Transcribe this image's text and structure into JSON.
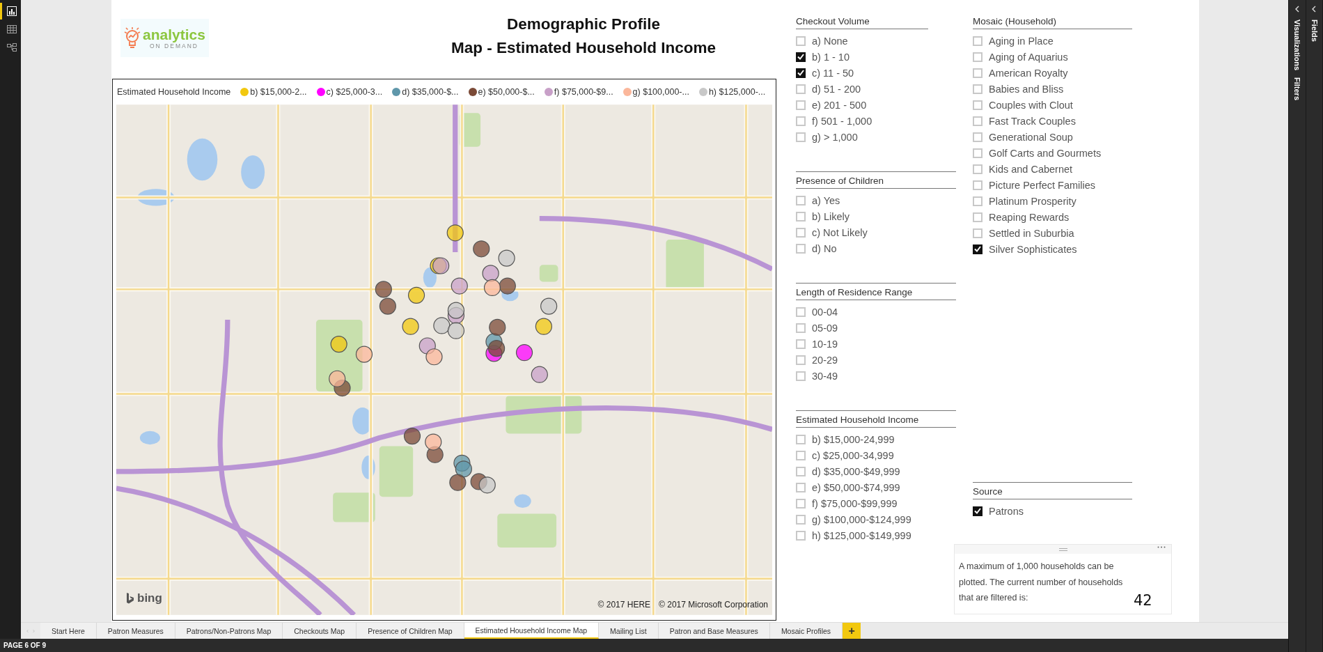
{
  "rail": {
    "icons": [
      {
        "kind": "report",
        "selected": true
      },
      {
        "kind": "data",
        "selected": false
      },
      {
        "kind": "model",
        "selected": false
      }
    ]
  },
  "logo": {
    "word": "analytics",
    "tagline": "ON DEMAND"
  },
  "title": [
    "Demographic Profile",
    "Map - Estimated Household Income"
  ],
  "map": {
    "legend_title": "Estimated Household Income",
    "legend": [
      {
        "label": "b) $15,000-2...",
        "color": "#f2c80f"
      },
      {
        "label": "c) $25,000-3...",
        "color": "#ff00ff"
      },
      {
        "label": "d) $35,000-$...",
        "color": "#5f97aa"
      },
      {
        "label": "e) $50,000-$...",
        "color": "#7b4a37"
      },
      {
        "label": "f) $75,000-$9...",
        "color": "#c8a0c8"
      },
      {
        "label": "g) $100,000-...",
        "color": "#fbb79b"
      },
      {
        "label": "h) $125,000-...",
        "color": "#c8c8c8"
      }
    ],
    "provider": "bing",
    "attribution": [
      "© 2017 HERE",
      "© 2017 Microsoft Corporation"
    ]
  },
  "slicers_left": [
    {
      "title": "Checkout Volume",
      "items": [
        {
          "label": "a) None",
          "checked": false
        },
        {
          "label": "b) 1 - 10",
          "checked": true
        },
        {
          "label": "c) 11 - 50",
          "checked": true
        },
        {
          "label": "d) 51 - 200",
          "checked": false
        },
        {
          "label": "e) 201 - 500",
          "checked": false
        },
        {
          "label": "f) 501 - 1,000",
          "checked": false
        },
        {
          "label": "g) > 1,000",
          "checked": false
        }
      ]
    },
    {
      "title": "Presence of Children",
      "items": [
        {
          "label": "a) Yes",
          "checked": false
        },
        {
          "label": "b) Likely",
          "checked": false
        },
        {
          "label": "c) Not Likely",
          "checked": false
        },
        {
          "label": "d) No",
          "checked": false
        }
      ]
    },
    {
      "title": "Length of Residence Range",
      "items": [
        {
          "label": "00-04",
          "checked": false
        },
        {
          "label": "05-09",
          "checked": false
        },
        {
          "label": "10-19",
          "checked": false
        },
        {
          "label": "20-29",
          "checked": false
        },
        {
          "label": "30-49",
          "checked": false
        }
      ]
    },
    {
      "title": "Estimated Household Income",
      "items": [
        {
          "label": "b) $15,000-24,999",
          "checked": false
        },
        {
          "label": "c) $25,000-34,999",
          "checked": false
        },
        {
          "label": "d) $35,000-$49,999",
          "checked": false
        },
        {
          "label": "e) $50,000-$74,999",
          "checked": false
        },
        {
          "label": "f) $75,000-$99,999",
          "checked": false
        },
        {
          "label": "g) $100,000-$124,999",
          "checked": false
        },
        {
          "label": "h) $125,000-$149,999",
          "checked": false
        }
      ]
    }
  ],
  "slicers_right": [
    {
      "title": "Mosaic (Household)",
      "items": [
        {
          "label": "Aging in Place",
          "checked": false
        },
        {
          "label": "Aging of Aquarius",
          "checked": false
        },
        {
          "label": "American Royalty",
          "checked": false
        },
        {
          "label": "Babies and Bliss",
          "checked": false
        },
        {
          "label": "Couples with Clout",
          "checked": false
        },
        {
          "label": "Fast Track Couples",
          "checked": false
        },
        {
          "label": "Generational Soup",
          "checked": false
        },
        {
          "label": "Golf Carts and Gourmets",
          "checked": false
        },
        {
          "label": "Kids and Cabernet",
          "checked": false
        },
        {
          "label": "Picture Perfect Families",
          "checked": false
        },
        {
          "label": "Platinum Prosperity",
          "checked": false
        },
        {
          "label": "Reaping Rewards",
          "checked": false
        },
        {
          "label": "Settled in Suburbia",
          "checked": false
        },
        {
          "label": "Silver Sophisticates",
          "checked": true
        }
      ]
    },
    {
      "title": "Source",
      "items": [
        {
          "label": "Patrons",
          "checked": true
        }
      ]
    }
  ],
  "textbox": {
    "text": "A maximum of 1,000 households can be plotted. The current number of households that are filtered is:",
    "count": "42"
  },
  "tabs": [
    {
      "label": "Start Here",
      "selected": false
    },
    {
      "label": "Patron Measures",
      "selected": false
    },
    {
      "label": "Patrons/Non-Patrons Map",
      "selected": false
    },
    {
      "label": "Checkouts Map",
      "selected": false
    },
    {
      "label": "Presence of Children Map",
      "selected": false
    },
    {
      "label": "Estimated Household Income Map",
      "selected": true
    },
    {
      "label": "Mailing List",
      "selected": false
    },
    {
      "label": "Patron and Base Measures",
      "selected": false
    },
    {
      "label": "Mosaic Profiles",
      "selected": false
    }
  ],
  "add_tab": "+",
  "status_bar": "PAGE 6 OF 9",
  "panes": [
    {
      "label": "Visualizations"
    },
    {
      "label": "Filters"
    },
    {
      "label": "Fields"
    }
  ]
}
